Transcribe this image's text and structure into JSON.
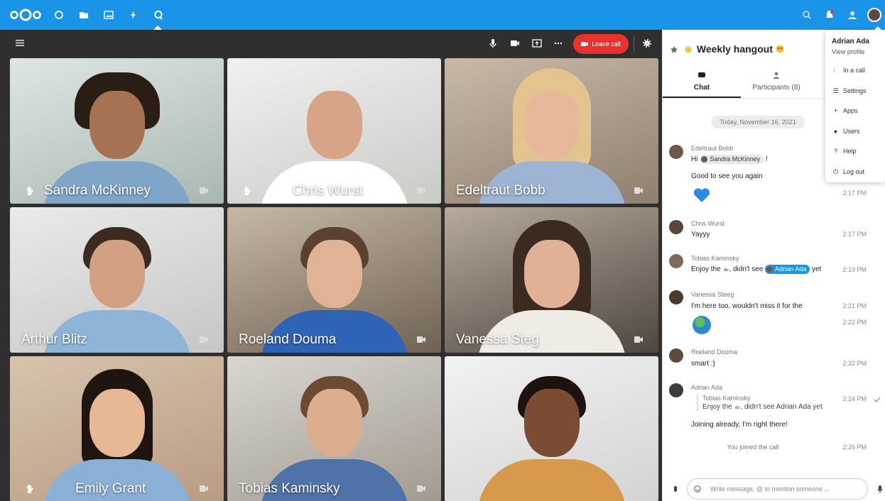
{
  "topbar": {
    "apps": [
      "dashboard-icon",
      "files-icon",
      "photos-icon",
      "activity-icon",
      "talk-icon"
    ],
    "right_icons": [
      "search-icon",
      "notifications-icon",
      "contacts-icon"
    ]
  },
  "call": {
    "leave_label": "Leave call",
    "controls": [
      "microphone-icon",
      "camera-icon",
      "screen-share-icon",
      "more-icon",
      "settings-icon"
    ],
    "participants": [
      {
        "name": "Sandra McKinney",
        "hand_raised": true
      },
      {
        "name": "Chris Wurst",
        "hand_raised": true
      },
      {
        "name": "Edeltraut Bobb",
        "hand_raised": false
      },
      {
        "name": "Arthur Blitz",
        "hand_raised": false
      },
      {
        "name": "Roeland Douma",
        "hand_raised": false
      },
      {
        "name": "Vanessa Steg",
        "hand_raised": false
      },
      {
        "name": "Emily Grant",
        "hand_raised": true
      },
      {
        "name": "Tobias Kaminsky",
        "hand_raised": false
      },
      {
        "name": "",
        "hand_raised": false
      }
    ]
  },
  "sidebar": {
    "room_title": "Weekly hangout",
    "tabs": {
      "chat": "Chat",
      "participants": "Participants (8)"
    },
    "date_separator": "Today, November 16, 2021",
    "messages": {
      "m1": {
        "author": "Edeltraut Bobb",
        "greeting": "Hi",
        "mention": "Sandra McKinney",
        "tail": "!",
        "line2": "Good to see you again",
        "time": "2:17 PM"
      },
      "m2": {
        "author": "Chris Wurst",
        "text": "Yayyy",
        "time": "2:17 PM"
      },
      "m3": {
        "author": "Tobias Kaminsky",
        "pre": "Enjoy the ☕, didn't see",
        "mention": "Adrian Ada",
        "post": "yet",
        "time": "2:19 PM"
      },
      "m4": {
        "author": "Vanessa Steeg",
        "text": "I'm here too, wouldn't miss it for the",
        "time": "2:21 PM",
        "time2": "2:22 PM"
      },
      "m5": {
        "author": "Roeland Douma",
        "text": "smart :)",
        "time": "2:22 PM"
      },
      "m6": {
        "author": "Adrian Ada",
        "quote_author": "Tobias Kaminsky",
        "quote_text": "Enjoy the ☕, didn't see Adrian Ada yet",
        "text": "Joining already, I'm right there!",
        "time": "2:24 PM"
      },
      "system": {
        "text": "You joined the call",
        "time": "2:26 PM"
      }
    },
    "composer_placeholder": "Write message, @ to mention someone ..."
  },
  "user_menu": {
    "name": "Adrian Ada",
    "view_profile": "View profile",
    "status": "In a call",
    "items": [
      "Settings",
      "Apps",
      "Users",
      "Help",
      "Log out"
    ]
  },
  "colors": {
    "brand": "#1a94e8",
    "leave": "#e9322d",
    "call_bg": "#2f2f2f"
  }
}
